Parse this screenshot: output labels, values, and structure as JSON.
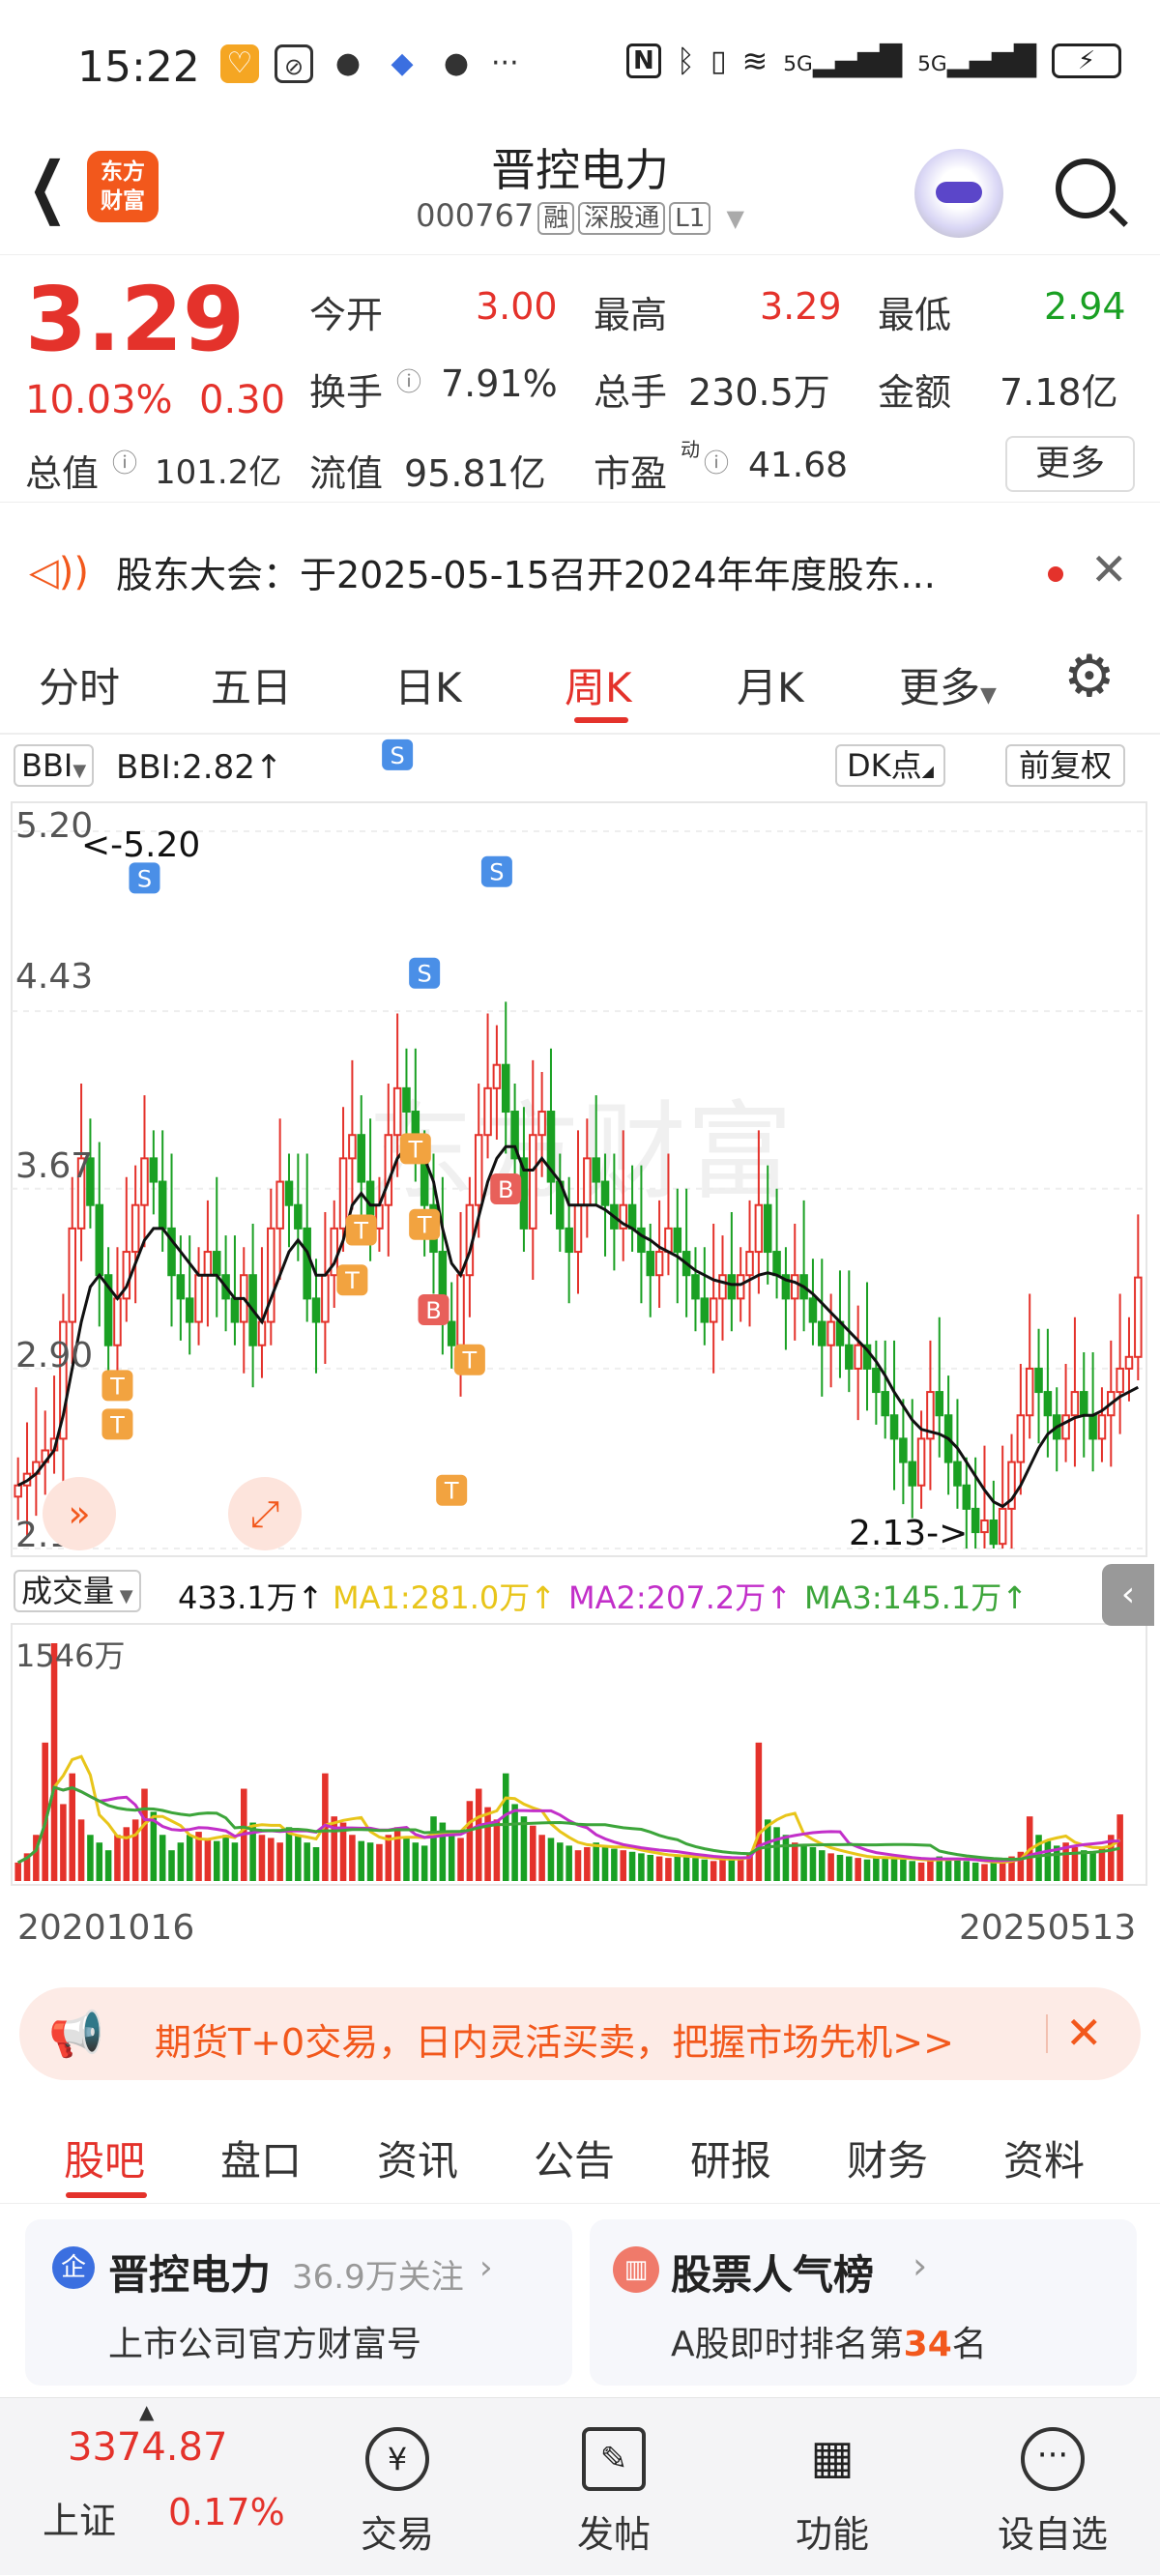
{
  "status_bar": {
    "time": "15:22",
    "more": "···",
    "signal_5g": "5G"
  },
  "header": {
    "logo": [
      "东方",
      "财富"
    ],
    "title": "晋控电力",
    "code": "000767",
    "tags": [
      "融",
      "深股通",
      "L1"
    ]
  },
  "quote": {
    "price": "3.29",
    "change_pct": "10.03%",
    "change": "0.30",
    "open_label": "今开",
    "open": "3.00",
    "high_label": "最高",
    "high": "3.29",
    "low_label": "最低",
    "low": "2.94",
    "turnover_label": "换手",
    "turnover": "7.91%",
    "volume_label": "总手",
    "volume": "230.5万",
    "amount_label": "金额",
    "amount": "7.18亿",
    "mcap_label": "总值",
    "mcap": "101.2亿",
    "float_label": "流值",
    "float": "95.81亿",
    "pe_label": "市盈",
    "pe_sup": "动",
    "pe": "41.68",
    "more_button": "更多"
  },
  "notice": {
    "text": "股东大会：于2025-05-15召开2024年年度股东..."
  },
  "chart_tabs": {
    "items": [
      "分时",
      "五日",
      "日K",
      "周K",
      "月K",
      "更多"
    ],
    "active": "周K"
  },
  "chart_toolbar": {
    "indicator": "BBI",
    "bbi_value": "BBI:2.82↑",
    "dk_button": "DK点",
    "adjust_button": "前复权"
  },
  "chart_data": {
    "type": "candlestick",
    "period": "weekly",
    "y_ticks": [
      "5.20",
      "4.43",
      "3.67",
      "2.90",
      "2.13"
    ],
    "ylim": [
      2.13,
      5.2
    ],
    "max_marker": "<-5.20",
    "min_marker": "2.13->",
    "x_start": "20201016",
    "x_end": "20250513",
    "close": [
      2.4,
      2.45,
      2.5,
      2.55,
      2.6,
      3.1,
      3.5,
      3.8,
      3.6,
      3.3,
      3.0,
      3.2,
      3.4,
      3.6,
      3.8,
      3.7,
      3.5,
      3.3,
      3.2,
      3.1,
      3.3,
      3.4,
      3.3,
      3.2,
      3.1,
      3.3,
      3.0,
      3.1,
      3.5,
      3.7,
      3.6,
      3.5,
      3.2,
      3.1,
      3.3,
      3.5,
      3.8,
      3.9,
      3.7,
      3.5,
      3.6,
      3.9,
      4.1,
      4.0,
      3.8,
      3.6,
      3.4,
      3.1,
      3.0,
      3.3,
      3.6,
      3.9,
      4.1,
      4.2,
      4.0,
      3.8,
      3.5,
      3.9,
      4.0,
      3.7,
      3.5,
      3.4,
      3.6,
      3.8,
      3.7,
      3.6,
      3.5,
      3.6,
      3.5,
      3.4,
      3.3,
      3.4,
      3.5,
      3.4,
      3.3,
      3.2,
      3.1,
      3.2,
      3.3,
      3.2,
      3.3,
      3.4,
      3.6,
      3.4,
      3.3,
      3.2,
      3.3,
      3.2,
      3.1,
      3.0,
      3.1,
      3.0,
      2.9,
      3.0,
      2.9,
      2.8,
      2.7,
      2.6,
      2.5,
      2.4,
      2.6,
      2.8,
      2.7,
      2.5,
      2.4,
      2.3,
      2.2,
      2.25,
      2.15,
      2.3,
      2.5,
      2.7,
      2.9,
      2.8,
      2.7,
      2.6,
      2.7,
      2.8,
      2.7,
      2.6,
      2.7,
      2.8,
      2.9,
      2.95,
      3.29
    ],
    "bbi": [
      2.4,
      2.42,
      2.45,
      2.5,
      2.55,
      2.7,
      2.9,
      3.1,
      3.25,
      3.3,
      3.25,
      3.2,
      3.25,
      3.35,
      3.45,
      3.5,
      3.5,
      3.45,
      3.4,
      3.35,
      3.3,
      3.3,
      3.3,
      3.25,
      3.2,
      3.2,
      3.15,
      3.1,
      3.2,
      3.3,
      3.4,
      3.45,
      3.4,
      3.3,
      3.3,
      3.35,
      3.45,
      3.6,
      3.65,
      3.6,
      3.6,
      3.7,
      3.8,
      3.85,
      3.85,
      3.8,
      3.7,
      3.5,
      3.35,
      3.3,
      3.4,
      3.55,
      3.7,
      3.8,
      3.85,
      3.85,
      3.75,
      3.75,
      3.8,
      3.75,
      3.7,
      3.6,
      3.6,
      3.6,
      3.6,
      3.58,
      3.55,
      3.52,
      3.5,
      3.47,
      3.45,
      3.42,
      3.4,
      3.38,
      3.35,
      3.32,
      3.3,
      3.28,
      3.27,
      3.26,
      3.26,
      3.28,
      3.3,
      3.31,
      3.3,
      3.28,
      3.27,
      3.25,
      3.22,
      3.18,
      3.14,
      3.1,
      3.06,
      3.02,
      2.98,
      2.93,
      2.87,
      2.8,
      2.74,
      2.68,
      2.64,
      2.63,
      2.62,
      2.6,
      2.56,
      2.5,
      2.44,
      2.38,
      2.33,
      2.31,
      2.34,
      2.4,
      2.48,
      2.56,
      2.62,
      2.65,
      2.67,
      2.69,
      2.7,
      2.7,
      2.72,
      2.75,
      2.78,
      2.8,
      2.82
    ]
  },
  "volume_toolbar": {
    "label": "成交量",
    "value": "433.1万↑",
    "ma1": "MA1:281.0万↑",
    "ma2": "MA2:207.2万↑",
    "ma3": "MA3:145.1万↑",
    "max": "1546万"
  },
  "volume_data": [
    120,
    180,
    300,
    900,
    1546,
    500,
    700,
    400,
    300,
    250,
    200,
    300,
    350,
    400,
    600,
    450,
    300,
    200,
    250,
    300,
    320,
    280,
    260,
    300,
    250,
    600,
    380,
    300,
    280,
    250,
    350,
    300,
    250,
    220,
    700,
    420,
    380,
    300,
    260,
    250,
    240,
    300,
    350,
    280,
    250,
    230,
    420,
    380,
    300,
    280,
    520,
    600,
    480,
    400,
    700,
    500,
    420,
    360,
    300,
    280,
    250,
    230,
    200,
    220,
    250,
    230,
    210,
    200,
    190,
    180,
    170,
    160,
    150,
    170,
    160,
    150,
    140,
    130,
    140,
    150,
    160,
    180,
    900,
    400,
    350,
    300,
    250,
    230,
    220,
    200,
    180,
    170,
    160,
    150,
    140,
    150,
    160,
    150,
    140,
    130,
    120,
    140,
    160,
    150,
    140,
    130,
    120,
    110,
    120,
    130,
    160,
    190,
    420,
    300,
    260,
    230,
    250,
    220,
    200,
    190,
    220,
    300,
    433
  ],
  "promo": {
    "text": "期货T+0交易，日内灵活买卖，把握市场先机>>"
  },
  "bottom_tabs": {
    "items": [
      "股吧",
      "盘口",
      "资讯",
      "公告",
      "研报",
      "财务",
      "资料"
    ],
    "active": "股吧"
  },
  "cards": [
    {
      "title": "晋控电力",
      "meta": "36.9万关注",
      "sub": "上市公司官方财富号"
    },
    {
      "title": "股票人气榜",
      "sub_prefix": "A股即时排名第",
      "rank": "34",
      "sub_suffix": "名"
    }
  ],
  "bottom_nav": {
    "index_value": "3374.87",
    "index_name": "上证",
    "index_change": "0.17%",
    "items": [
      "交易",
      "发帖",
      "功能",
      "设自选"
    ]
  },
  "colors": {
    "up": "#e4322b",
    "down": "#1aa023",
    "accent": "#f2581c",
    "ma1": "#e8c51a",
    "ma2": "#c22fc9",
    "ma3": "#3ca53a"
  }
}
